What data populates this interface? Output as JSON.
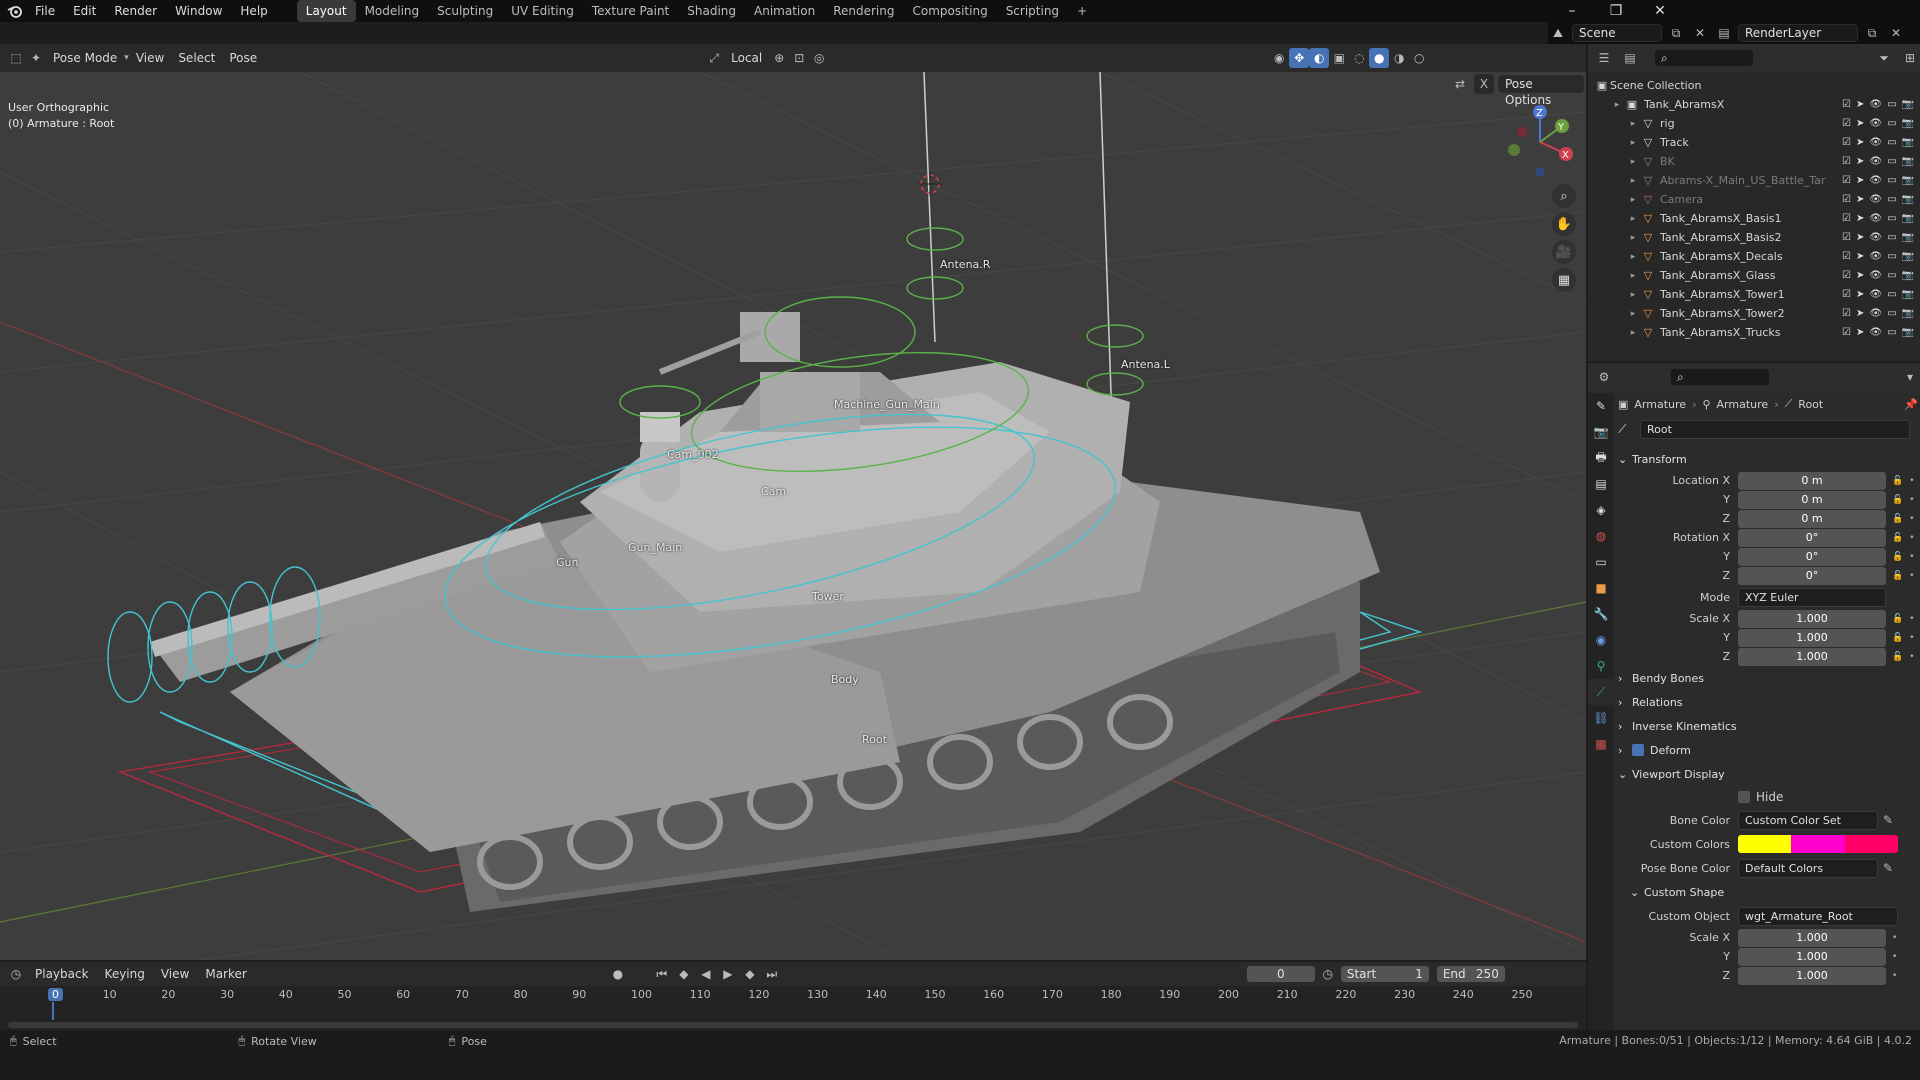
{
  "menu": [
    "File",
    "Edit",
    "Render",
    "Window",
    "Help"
  ],
  "workspaces": [
    "Layout",
    "Modeling",
    "Sculpting",
    "UV Editing",
    "Texture Paint",
    "Shading",
    "Animation",
    "Rendering",
    "Compositing",
    "Scripting"
  ],
  "add_workspace": "+",
  "scene": {
    "label": "Scene",
    "layer": "RenderLayer"
  },
  "window_controls": {
    "min": "–",
    "max": "❐",
    "close": "✕"
  },
  "viewport_header": {
    "mode": "Pose Mode",
    "menus": [
      "View",
      "Select",
      "Pose"
    ],
    "transform_orientation": "Local",
    "pose_options": "Pose Options"
  },
  "viewport": {
    "view_name": "User Orthographic",
    "object_info": "(0) Armature : Root",
    "bone_labels": [
      "Antena.R",
      "Antena.L",
      "Machine_Gun_Main",
      "Cam_002",
      "Cam",
      "Gun",
      "Gun_Main",
      "Tower",
      "Body",
      "Root"
    ],
    "gizmo": {
      "x": "X",
      "y": "Y",
      "z": "Z"
    },
    "x_toggle": "X"
  },
  "outliner": {
    "root": "Scene Collection",
    "items": [
      {
        "name": "Tank_AbramsX",
        "level": 1,
        "dim": false,
        "icon_color": "#ddd"
      },
      {
        "name": "rig",
        "level": 2,
        "dim": false,
        "icon_color": "#ddd"
      },
      {
        "name": "Track",
        "level": 2,
        "dim": false,
        "icon_color": "#ddd"
      },
      {
        "name": "BK",
        "level": 2,
        "dim": true,
        "icon_color": "#888"
      },
      {
        "name": "Abrams-X_Main_US_Battle_Tar",
        "level": 2,
        "dim": true,
        "icon_color": "#888"
      },
      {
        "name": "Camera",
        "level": 2,
        "dim": true,
        "icon_color": "#b07050"
      },
      {
        "name": "Tank_AbramsX_Basis1",
        "level": 2,
        "dim": false,
        "icon_color": "#e89a4a"
      },
      {
        "name": "Tank_AbramsX_Basis2",
        "level": 2,
        "dim": false,
        "icon_color": "#e89a4a"
      },
      {
        "name": "Tank_AbramsX_Decals",
        "level": 2,
        "dim": false,
        "icon_color": "#e89a4a"
      },
      {
        "name": "Tank_AbramsX_Glass",
        "level": 2,
        "dim": false,
        "icon_color": "#e89a4a"
      },
      {
        "name": "Tank_AbramsX_Tower1",
        "level": 2,
        "dim": false,
        "icon_color": "#e89a4a"
      },
      {
        "name": "Tank_AbramsX_Tower2",
        "level": 2,
        "dim": false,
        "icon_color": "#e89a4a"
      },
      {
        "name": "Tank_AbramsX_Trucks",
        "level": 2,
        "dim": false,
        "icon_color": "#e89a4a"
      }
    ]
  },
  "properties": {
    "breadcrumb": [
      "Armature",
      "Armature",
      "Root"
    ],
    "bone_name": "Root",
    "transform": {
      "title": "Transform",
      "location_x_label": "Location X",
      "location_x": "0 m",
      "location_y_label": "Y",
      "location_y": "0 m",
      "location_z_label": "Z",
      "location_z": "0 m",
      "rotation_x_label": "Rotation X",
      "rotation_x": "0°",
      "rotation_y_label": "Y",
      "rotation_y": "0°",
      "rotation_z_label": "Z",
      "rotation_z": "0°",
      "mode_label": "Mode",
      "mode": "XYZ Euler",
      "scale_x_label": "Scale X",
      "scale_x": "1.000",
      "scale_y_label": "Y",
      "scale_y": "1.000",
      "scale_z_label": "Z",
      "scale_z": "1.000"
    },
    "panels": {
      "bendy": "Bendy Bones",
      "relations": "Relations",
      "ik": "Inverse Kinematics",
      "deform": "Deform"
    },
    "viewport_display": {
      "title": "Viewport Display",
      "hide": "Hide",
      "bone_color_label": "Bone Color",
      "bone_color": "Custom Color Set",
      "custom_colors_label": "Custom Colors",
      "custom_colors": [
        "#ffff00",
        "#ff00cc",
        "#ff0066"
      ],
      "pose_bone_color_label": "Pose Bone Color",
      "pose_bone_color": "Default Colors"
    },
    "custom_shape": {
      "title": "Custom Shape",
      "object_label": "Custom Object",
      "object": "wgt_Armature_Root",
      "scale_x_label": "Scale X",
      "scale_x": "1.000",
      "scale_y_label": "Y",
      "scale_y": "1.000",
      "scale_z_label": "Z",
      "scale_z": "1.000"
    }
  },
  "timeline": {
    "menus": [
      "Playback",
      "Keying",
      "View",
      "Marker"
    ],
    "current_frame": "0",
    "start_label": "Start",
    "start": "1",
    "end_label": "End",
    "end": "250",
    "ticks": [
      "0",
      "10",
      "20",
      "30",
      "40",
      "50",
      "60",
      "70",
      "80",
      "90",
      "100",
      "110",
      "120",
      "130",
      "140",
      "150",
      "160",
      "170",
      "180",
      "190",
      "200",
      "210",
      "220",
      "230",
      "240",
      "250"
    ]
  },
  "statusbar": {
    "select": "Select",
    "rotate": "Rotate View",
    "pose": "Pose",
    "stats": "Armature | Bones:0/51 | Objects:1/12 | Memory: 4.64 GiB | 4.0.2"
  }
}
